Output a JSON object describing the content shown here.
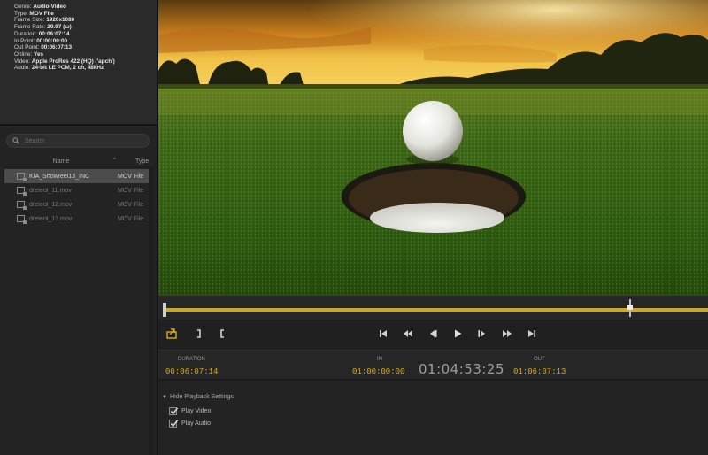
{
  "metadata": {
    "rows": [
      {
        "k": "Genre:",
        "v": "Audio-Video"
      },
      {
        "k": "Type:",
        "v": "MOV File"
      },
      {
        "k": "Frame Size:",
        "v": "1920x1080"
      },
      {
        "k": "Frame Rate:",
        "v": "29.97 (ω)"
      },
      {
        "k": "Duration:",
        "v": "00:06:07:14"
      },
      {
        "k": "In Point:",
        "v": "00:00:00:00"
      },
      {
        "k": "Out Point:",
        "v": "00:06:07:13"
      },
      {
        "k": "Online:",
        "v": "Yes"
      },
      {
        "k": "Video:",
        "v": "Apple ProRes 422 (HQ) ('apch')"
      },
      {
        "k": "Audio:",
        "v": "24-bit LE PCM, 2 ch, 48kHz"
      }
    ]
  },
  "search": {
    "placeholder": "Search"
  },
  "columns": {
    "name": "Name",
    "type": "Type",
    "sort_indicator": "^"
  },
  "files": [
    {
      "name": "KIA_Showreel13_INC",
      "type": "MOV File",
      "selected": true
    },
    {
      "name": "dreteol_11.mov",
      "type": "MOV File",
      "selected": false
    },
    {
      "name": "dreteol_12.mov",
      "type": "MOV File",
      "selected": false
    },
    {
      "name": "dreteol_13.mov",
      "type": "MOV File",
      "selected": false
    }
  ],
  "timecodes": {
    "duration_label": "DURATION",
    "duration_value": "00:06:07:14",
    "in_label": "IN",
    "in_value": "01:00:00:00",
    "current": "01:04:53:25",
    "out_label": "OUT",
    "out_value": "01:06:07:13"
  },
  "playback_settings": {
    "header": "Hide Playback Settings",
    "play_video": "Play Video",
    "play_audio": "Play Audio",
    "play_video_checked": true,
    "play_audio_checked": true
  },
  "colors": {
    "accent": "#d9ab1f",
    "panel": "#232323"
  }
}
